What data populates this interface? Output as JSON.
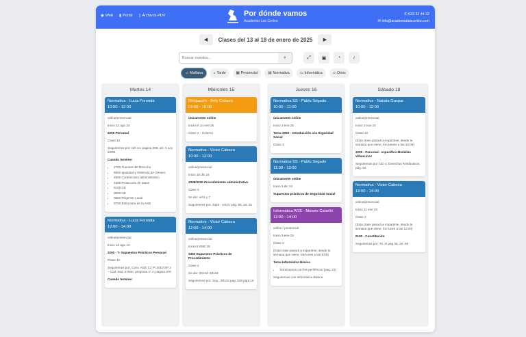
{
  "header": {
    "links": [
      {
        "icon": "globe-icon",
        "label": "Web"
      },
      {
        "icon": "user-icon",
        "label": "Portal"
      },
      {
        "icon": "file-icon",
        "label": "Archivos PDV"
      }
    ],
    "title": "Por dónde vamos",
    "subtitle": "Academia Las Cortes",
    "phone": "633 32 44 32",
    "email": "info@academialascortes.com"
  },
  "week": {
    "title": "Clases del 13 al 18 de enero de 2025",
    "prev": "◀",
    "next": "▶"
  },
  "search": {
    "placeholder": "Buscar eventos..."
  },
  "filters": [
    {
      "label": "Mañana",
      "icon": "sun-icon",
      "glyph": "☼",
      "active": true
    },
    {
      "label": "Tarde",
      "icon": "sunset-icon",
      "glyph": "◒"
    },
    {
      "label": "Presencial",
      "icon": "building-icon",
      "glyph": "▦"
    },
    {
      "label": "Normativa",
      "icon": "book-icon",
      "glyph": "▤"
    },
    {
      "label": "Informática",
      "icon": "monitor-icon",
      "glyph": "▭"
    },
    {
      "label": "Otros",
      "icon": "folder-icon",
      "glyph": "▱"
    }
  ],
  "colors": {
    "normativa": "#2a7ab8",
    "relajacion": "#f39c12",
    "informatica": "#8e44ad",
    "brand": "#3f6ff4"
  },
  "days": [
    {
      "name": "Martes 14",
      "events": [
        {
          "title": "Normativa - Lucia Foronda",
          "time": "10:00 - 12:00",
          "color": "#2a7ab8",
          "lines": [
            [
              "n",
              "online/presencial"
            ],
            [
              "n",
              "Inicio 13 ago 24"
            ],
            [
              "b",
              "2200 Personal"
            ],
            [
              "n",
              "Clase 12"
            ],
            [
              "n",
              "Seguiremos por: UD 14, pagina 208, art. 3 Ley 53/84"
            ],
            [
              "b",
              "Cuando termine:"
            ],
            [
              "l",
              [
                "2700 Fuentes del Derecho",
                "9900 Igualdad y Violencia de Género",
                "2600 Contencioso administrativo",
                "2300 Protección de datos",
                "0100 CE",
                "0500 UE",
                "0600 Régimen Local",
                "0700 Estructura de la AGE"
              ]
            ]
          ]
        },
        {
          "title": "Normativa - Lucia Foronda",
          "time": "12:00 - 14:00",
          "color": "#2a7ab8",
          "lines": [
            [
              "n",
              "online/presencial"
            ],
            [
              "n",
              "Inicio 13 ago 24"
            ],
            [
              "b",
              "2200 - T- Supuestos Prácticos Personal"
            ],
            [
              "n",
              "Clase 12"
            ],
            [
              "n",
              "Seguiremos por: Conv. AGE C1 PI 2010 SP 2 – Cód. test: 27940, pregunta nº 4, pagina 370"
            ],
            [
              "b",
              "Cuando termine:"
            ]
          ]
        }
      ]
    },
    {
      "name": "Miércoles 15",
      "events": [
        {
          "title": "Relajación - Bely Cabeza",
          "time": "09:00 - 10:00",
          "color": "#f39c12",
          "lines": [
            [
              "b",
              "únicamente online"
            ],
            [
              "n",
              "Inicio el 14 ene 25"
            ],
            [
              "n",
              "Clase 2 - Invierno"
            ]
          ]
        },
        {
          "title": "Normativa - Victor Cabeza",
          "time": "10:00 - 12:00",
          "color": "#2a7ab8",
          "lines": [
            [
              "n",
              "online/presencial"
            ],
            [
              "n",
              "Inicio 18 dic 24"
            ],
            [
              "b",
              "3339/3340 Procedimiento administrativo"
            ],
            [
              "n",
              "Clase 3"
            ],
            [
              "n",
              "Se dio: ud 6 y 7"
            ],
            [
              "n",
              "Seguiremos por: 3340 - UD 8, pág. 55, art. 81"
            ]
          ]
        },
        {
          "title": "Normativa - Victor Cabeza",
          "time": "12:00 - 14:00",
          "color": "#2a7ab8",
          "lines": [
            [
              "n",
              "online/presencial"
            ],
            [
              "n",
              "Inicio 8 ENE 25"
            ],
            [
              "b",
              "3302 Supuestos Prácticos de Procedimiento"
            ],
            [
              "n",
              "Clase 2"
            ],
            [
              "n",
              "Se dio: 28143, 28144"
            ],
            [
              "n",
              "Seguiremos por: Sup., 28144 pag. 548 pgta 16"
            ]
          ]
        }
      ]
    },
    {
      "name": "Jueves 16",
      "events": [
        {
          "title": "Normativa SS - Pablo Segado",
          "time": "10:00 - 11:00",
          "color": "#2a7ab8",
          "lines": [
            [
              "b",
              "únicamente online"
            ],
            [
              "n",
              "Inicio 2 ene 25"
            ],
            [
              "b",
              "Tema 3050 - Introducción a la Seguridad Social"
            ],
            [
              "n",
              "Clase 3"
            ]
          ]
        },
        {
          "title": "Normativa SS - Pablo Segado",
          "time": "11:00 - 13:00",
          "color": "#2a7ab8",
          "lines": [
            [
              "b",
              "únicamente online"
            ],
            [
              "n",
              "Inicio 5 dic 24"
            ],
            [
              "b",
              "Supuestos prácticos de Seguridad Social"
            ]
          ]
        },
        {
          "title": "Informática AGE - Moisés Cabello",
          "time": "12:00 - 14:00",
          "color": "#8e44ad",
          "lines": [
            [
              "n",
              "online / presencial"
            ],
            [
              "n",
              "Inicio 9 ene 25"
            ],
            [
              "n",
              "Clase 2"
            ],
            [
              "n",
              "(Esta clase pasará a impartirse, desde la semana que viene, los lunes a las 9:00)"
            ],
            [
              "b",
              "Tema Informática Básica"
            ],
            [
              "l",
              [
                "Terminamos con los periféricos (pag. 21)"
              ]
            ],
            [
              "n",
              "Seguiremos con Informática Básica"
            ]
          ]
        }
      ]
    },
    {
      "name": "Sábado 18",
      "events": [
        {
          "title": "Normativa - Natalia Gaspar",
          "time": "10:00 - 12:00",
          "color": "#2a7ab8",
          "lines": [
            [
              "n",
              "online/presencial"
            ],
            [
              "n",
              "Inicio 2 nov 24"
            ],
            [
              "n",
              "Clase 10"
            ],
            [
              "n",
              "(Esta clase pasará a impartirse, desde la semana que viene, los jueves a las 16:00)"
            ],
            [
              "b",
              "2200 - Personal - específico Medallas Villancicos"
            ],
            [
              "n",
              "Seguiremos por: UD 4: Derechos Retributivos, pág. 54"
            ]
          ]
        },
        {
          "title": "Normativa - Victor Cabeza",
          "time": "12:00 - 14:00",
          "color": "#2a7ab8",
          "lines": [
            [
              "n",
              "online/presencial"
            ],
            [
              "n",
              "Inicio 11 ene 25"
            ],
            [
              "n",
              "Clase 2"
            ],
            [
              "n",
              "(Esta clase pasará a impartirse, desde la semana que viene, los lunes a las 11:00)"
            ],
            [
              "b",
              "0100 - Constitución"
            ],
            [
              "n",
              "Seguiremos por: Tit. III pag 36, art. 69"
            ]
          ]
        }
      ]
    }
  ]
}
